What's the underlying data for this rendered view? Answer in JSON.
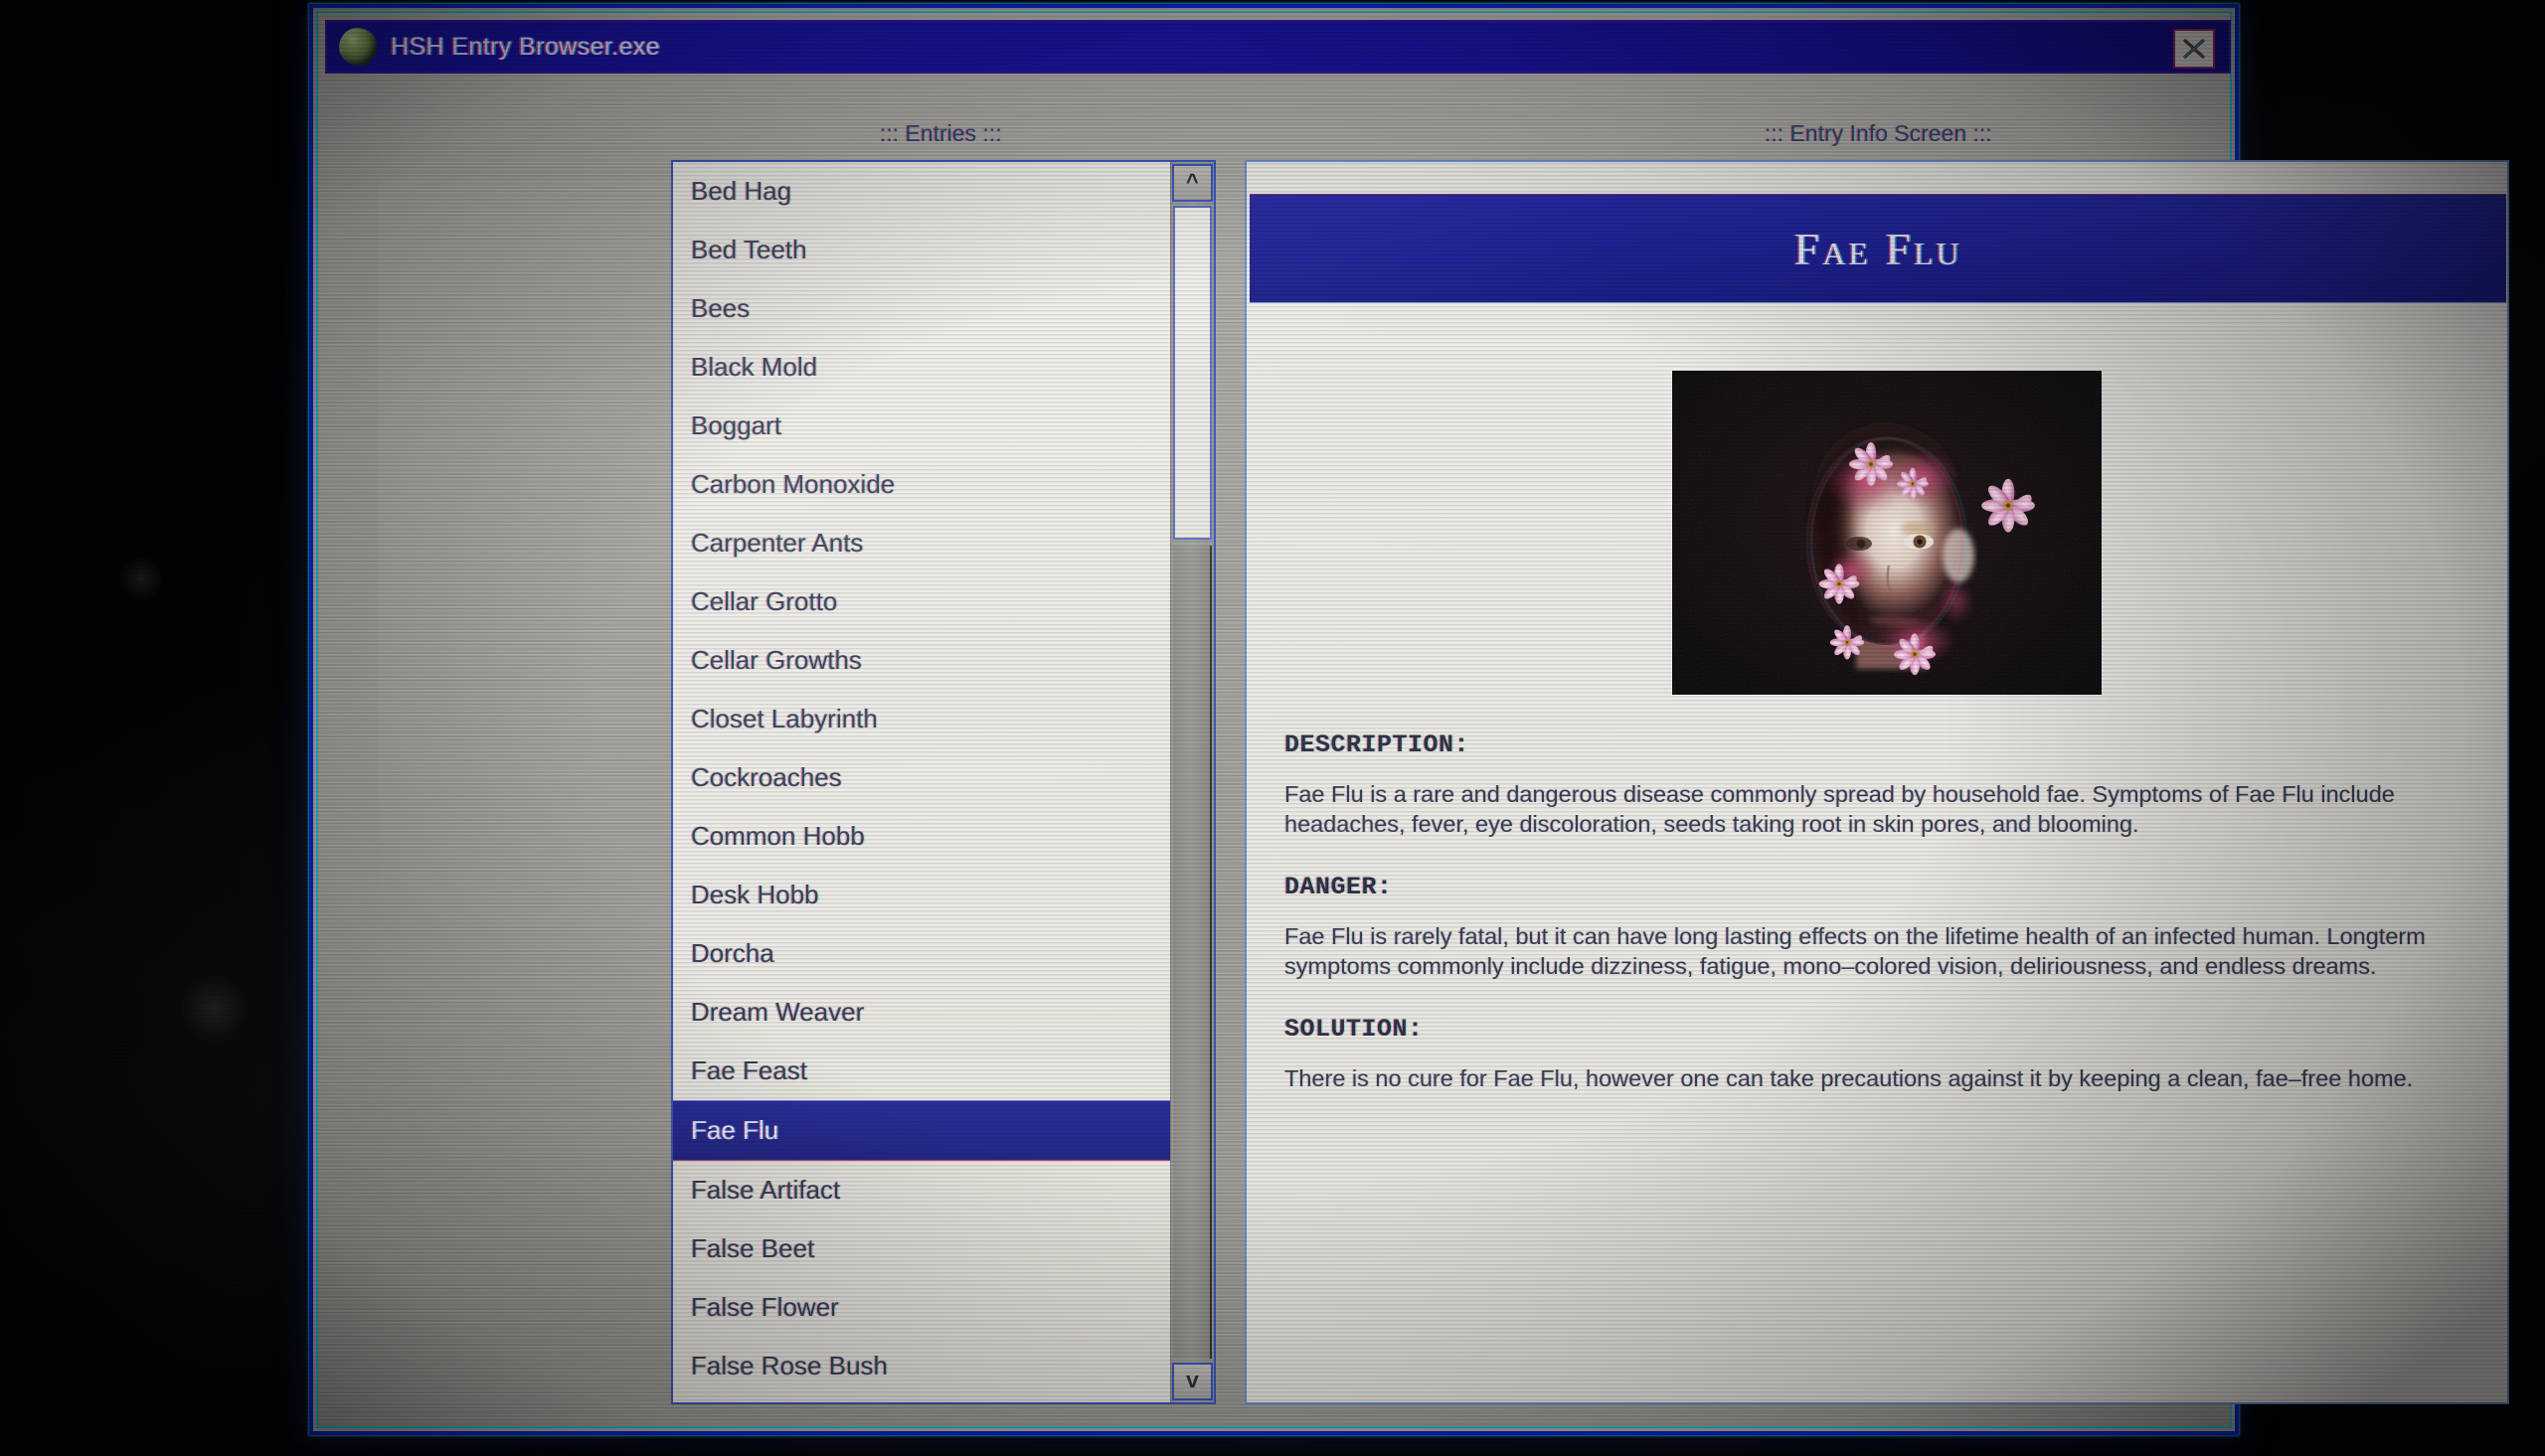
{
  "window": {
    "title": "HSH Entry Browser.exe",
    "icon": "brain-blob-icon",
    "close_label": "✕",
    "border_color": "#0b23c8",
    "titlebar_color": "#17139c"
  },
  "headers": {
    "entries": "::: Entries :::",
    "info": "::: Entry Info Screen :::"
  },
  "entries": {
    "selected": "Fae Flu",
    "items": [
      "Bed Hag",
      "Bed Teeth",
      "Bees",
      "Black Mold",
      "Boggart",
      "Carbon Monoxide",
      "Carpenter Ants",
      "Cellar Grotto",
      "Cellar Growths",
      "Closet Labyrinth",
      "Cockroaches",
      "Common Hobb",
      "Desk Hobb",
      "Dorcha",
      "Dream Weaver",
      "Fae Feast",
      "Fae Flu",
      "False Artifact",
      "False Beet",
      "False Flower",
      "False Rose Bush"
    ]
  },
  "scrollbar": {
    "up_label": "^",
    "down_label": "v"
  },
  "entry": {
    "title": "Fae Flu",
    "image_alt": "portrait of infected human with blooming flowers on face",
    "sections": [
      {
        "label": "DESCRIPTION:",
        "text": "Fae Flu is a rare and dangerous disease commonly spread by household fae. Symptoms of Fae Flu include headaches, fever, eye discoloration, seeds taking root in skin pores, and blooming."
      },
      {
        "label": "DANGER:",
        "text": "Fae Flu is rarely fatal, but it can have long lasting effects on the lifetime health of an infected human. Longterm symptoms commonly include dizziness, fatigue, mono–colored vision, deliriousness, and endless dreams."
      },
      {
        "label": "SOLUTION:",
        "text": "There is no cure for Fae Flu, however one can take precautions against it by keeping a clean, fae–free home."
      }
    ]
  }
}
